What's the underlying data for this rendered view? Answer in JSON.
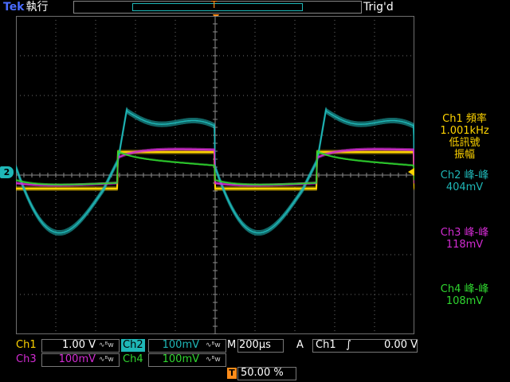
{
  "header": {
    "brand": "Tek",
    "run_status": "執行",
    "trigger_state": "Trig'd",
    "trigger_position_marker": "T"
  },
  "screen": {
    "ch2_marker_label": "2",
    "trigger_marker_label": "T"
  },
  "measurements": [
    {
      "label": "Ch1 頻率",
      "value": "1.001kHz",
      "note": "低訊號",
      "note2": "振幅",
      "color": "#ffd400"
    },
    {
      "label": "Ch2 峰-峰",
      "value": "404mV",
      "color": "#1fb7b7"
    },
    {
      "label": "Ch3 峰-峰",
      "value": "118mV",
      "color": "#d22bd2"
    },
    {
      "label": "Ch4 峰-峰",
      "value": "108mV",
      "color": "#2fd62f"
    }
  ],
  "channels": {
    "ch1": {
      "label": "Ch1",
      "scale": "1.00 V",
      "color": "#ffd400"
    },
    "ch2": {
      "label": "Ch2",
      "scale": "100mV",
      "color": "#1fb7b7"
    },
    "ch3": {
      "label": "Ch3",
      "scale": "100mV",
      "color": "#d22bd2"
    },
    "ch4": {
      "label": "Ch4",
      "scale": "100mV",
      "color": "#2fd62f"
    },
    "bw_symbol": "∿ᴮw"
  },
  "timebase": {
    "label": "M",
    "value": "200µs"
  },
  "trigger": {
    "mode": "A",
    "source": "Ch1",
    "slope_symbol": "∫",
    "level": "0.00 V",
    "position_icon": "T",
    "position": "50.00 %"
  },
  "colors": {
    "ch1": "#ffd400",
    "ch2": "#1fb7b7",
    "ch3": "#d22bd2",
    "ch4": "#2fd62f",
    "grid": "#6e6e6e",
    "trigger": "#ff8c1a"
  }
}
